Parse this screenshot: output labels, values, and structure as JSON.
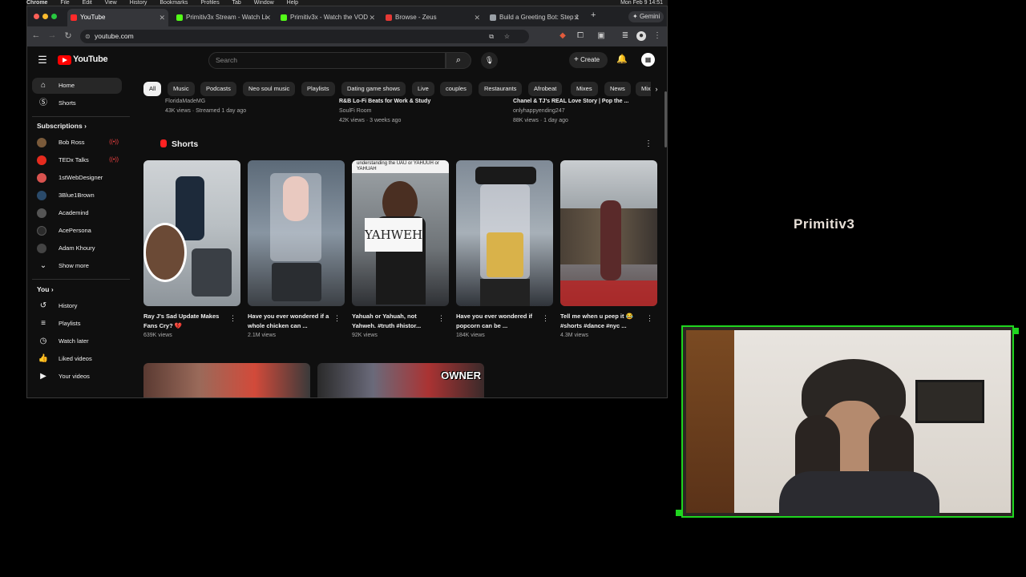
{
  "menubar": [
    "Chrome",
    "File",
    "Edit",
    "View",
    "History",
    "Bookmarks",
    "Profiles",
    "Tab",
    "Window",
    "Help"
  ],
  "menubar_clock": "Mon Feb 9  14:51",
  "tabs": [
    {
      "label": "YouTube",
      "color": "#ff2a2a",
      "active": true
    },
    {
      "label": "Primitiv3x Stream - Watch Li",
      "color": "#53fc18"
    },
    {
      "label": "Primitiv3x - Watch the VOD",
      "color": "#53fc18"
    },
    {
      "label": "Browse - Zeus",
      "color": "#e53935"
    },
    {
      "label": "Build a Greeting Bot: Step 1",
      "color": "#9aa0a6"
    }
  ],
  "gemini_label": "Gemini",
  "url": "youtube.com",
  "youtube": {
    "logo": "YouTube",
    "search_placeholder": "Search",
    "create_label": "Create"
  },
  "sidebar": {
    "main": [
      {
        "label": "Home",
        "icon": "home-icon"
      },
      {
        "label": "Shorts",
        "icon": "shorts-icon"
      }
    ],
    "subscriptions_header": "Subscriptions",
    "subscriptions": [
      {
        "label": "Bob Ross",
        "color": "#7a5a3a",
        "live": true
      },
      {
        "label": "TEDx Talks",
        "color": "#e62b1e",
        "live": true
      },
      {
        "label": "1stWebDesigner",
        "color": "#d9534f",
        "live": false
      },
      {
        "label": "3Blue1Brown",
        "color": "#2a4a6a",
        "live": false
      },
      {
        "label": "Academind",
        "color": "#555",
        "live": false
      },
      {
        "label": "AcePersona",
        "color": "#2b2b2b",
        "live": false
      },
      {
        "label": "Adam Khoury",
        "color": "#444",
        "live": false
      }
    ],
    "show_more": "Show more",
    "you_header": "You",
    "you_items": [
      {
        "label": "History",
        "icon": "history-icon"
      },
      {
        "label": "Playlists",
        "icon": "playlists-icon"
      },
      {
        "label": "Watch later",
        "icon": "watch-later-icon"
      },
      {
        "label": "Liked videos",
        "icon": "liked-icon"
      },
      {
        "label": "Your videos",
        "icon": "your-videos-icon"
      }
    ]
  },
  "chips": [
    "All",
    "Music",
    "Podcasts",
    "Neo soul music",
    "Playlists",
    "Dating game shows",
    "Live",
    "couples",
    "Restaurants",
    "Afrobeat",
    "Mixes",
    "News",
    "Mix"
  ],
  "previous_row": [
    {
      "channel": "FloridaMadeMG",
      "meta": "43K views · Streamed 1 day ago"
    },
    {
      "title": "R&B Lo-Fi Beats for Work & Study",
      "channel": "SoulFi Room",
      "meta": "42K views · 3 weeks ago"
    },
    {
      "title": "Chanel & TJ's REAL Love Story | Pop the ...",
      "channel": "onlyhappyending247",
      "meta": "88K views · 1 day ago"
    }
  ],
  "shorts_header": "Shorts",
  "shorts": [
    {
      "title": "Ray J's Sad Update Makes Fans Cry? 💔",
      "views": "639K views"
    },
    {
      "title": "Have you ever wondered if a whole chicken can ...",
      "views": "2.1M views"
    },
    {
      "title": "Yahuah or Yahuah, not Yahweh. #truth #histor...",
      "views": "92K views",
      "caption_top": "understanding the UAU or YAHUUH or YAHUAH",
      "sign": "YAHWEH"
    },
    {
      "title": "Have you ever wondered if popcorn can be ...",
      "views": "184K views"
    },
    {
      "title": "Tell me when u peep it 😂 #shorts #dance #nyc ...",
      "views": "4.3M views"
    }
  ],
  "next_row_overlay": "OWNER",
  "overlay_title": "Primitiv3"
}
